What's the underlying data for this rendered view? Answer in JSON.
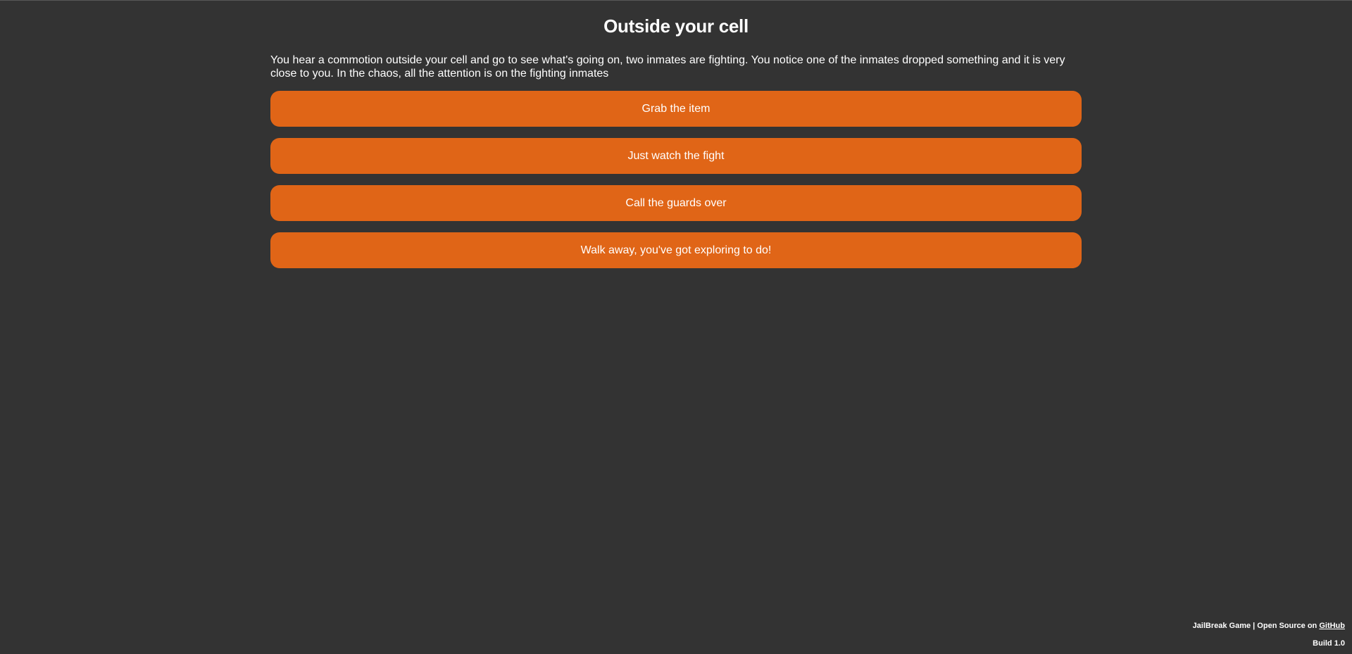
{
  "scene": {
    "title": "Outside your cell",
    "description": "You hear a commotion outside your cell and go to see what's going on, two inmates are fighting. You notice one of the inmates dropped something and it is very close to you. In the chaos, all the attention is on the fighting inmates"
  },
  "choices": [
    {
      "label": "Grab the item"
    },
    {
      "label": "Just watch the fight"
    },
    {
      "label": "Call the guards over"
    },
    {
      "label": "Walk away, you've got exploring to do!"
    }
  ],
  "footer": {
    "credit_text": "JailBreak Game | Open Source on ",
    "link_text": "GitHub",
    "build": "Build 1.0"
  },
  "colors": {
    "background": "#333333",
    "button": "#e06517",
    "text": "#ffffff"
  }
}
